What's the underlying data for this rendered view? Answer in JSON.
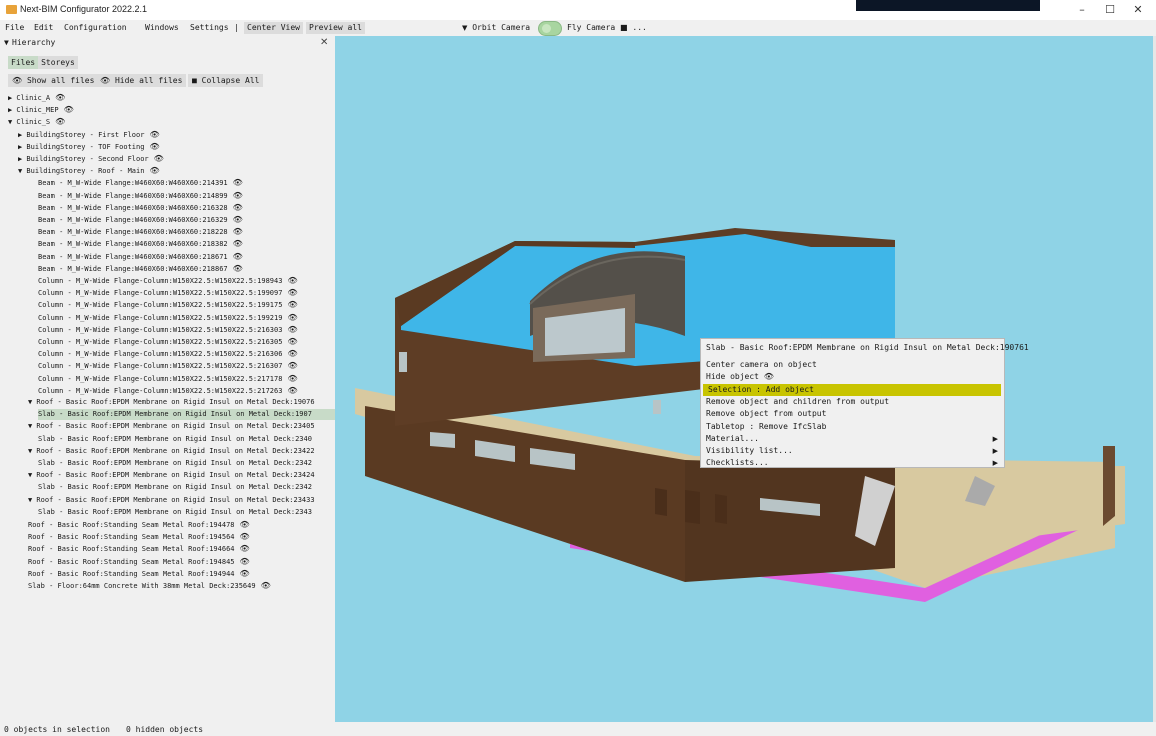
{
  "window": {
    "title": "Next-BIM Configurator 2022.2.1",
    "controls": {
      "minimize": "–",
      "maximize": "☐",
      "close": "✕"
    }
  },
  "menu": {
    "items": [
      "File",
      "Edit",
      "Configuration",
      "Windows",
      "Settings",
      "|",
      "Center View",
      "Preview all"
    ],
    "orbit_camera": "Orbit Camera",
    "fly_camera": "Fly Camera",
    "more": "..."
  },
  "hierarchy": {
    "title": "Hierarchy",
    "close": "✕",
    "tabs": [
      "Files",
      "Storeys"
    ],
    "toolbar": {
      "show_all": "Show all files",
      "hide_all": "Hide all files",
      "collapse_all": "Collapse All"
    },
    "tree": [
      {
        "text": "▶ Clinic_A",
        "indent": 0,
        "eye": true
      },
      {
        "text": "▶ Clinic_MEP",
        "indent": 0,
        "eye": true
      },
      {
        "text": "▼ Clinic_S",
        "indent": 0,
        "eye": true
      },
      {
        "text": "▶ BuildingStorey - First Floor",
        "indent": 1,
        "eye": true
      },
      {
        "text": "▶ BuildingStorey - TOF Footing",
        "indent": 1,
        "eye": true
      },
      {
        "text": "▶ BuildingStorey - Second Floor",
        "indent": 1,
        "eye": true
      },
      {
        "text": "▼ BuildingStorey - Roof - Main",
        "indent": 1,
        "eye": true
      },
      {
        "text": "Beam - M_W-Wide Flange:W460X60:W460X60:214391",
        "indent": 3,
        "eye": true
      },
      {
        "text": "Beam - M_W-Wide Flange:W460X60:W460X60:214899",
        "indent": 3,
        "eye": true
      },
      {
        "text": "Beam - M_W-Wide Flange:W460X60:W460X60:216328",
        "indent": 3,
        "eye": true
      },
      {
        "text": "Beam - M_W-Wide Flange:W460X60:W460X60:216329",
        "indent": 3,
        "eye": true
      },
      {
        "text": "Beam - M_W-Wide Flange:W460X60:W460X60:218228",
        "indent": 3,
        "eye": true
      },
      {
        "text": "Beam - M_W-Wide Flange:W460X60:W460X60:218382",
        "indent": 3,
        "eye": true
      },
      {
        "text": "Beam - M_W-Wide Flange:W460X60:W460X60:218671",
        "indent": 3,
        "eye": true
      },
      {
        "text": "Beam - M_W-Wide Flange:W460X60:W460X60:218867",
        "indent": 3,
        "eye": true
      },
      {
        "text": "Column - M_W-Wide Flange-Column:W150X22.5:W150X22.5:198943",
        "indent": 3,
        "eye": true
      },
      {
        "text": "Column - M_W-Wide Flange-Column:W150X22.5:W150X22.5:199097",
        "indent": 3,
        "eye": true
      },
      {
        "text": "Column - M_W-Wide Flange-Column:W150X22.5:W150X22.5:199175",
        "indent": 3,
        "eye": true
      },
      {
        "text": "Column - M_W-Wide Flange-Column:W150X22.5:W150X22.5:199219",
        "indent": 3,
        "eye": true
      },
      {
        "text": "Column - M_W-Wide Flange-Column:W150X22.5:W150X22.5:216303",
        "indent": 3,
        "eye": true
      },
      {
        "text": "Column - M_W-Wide Flange-Column:W150X22.5:W150X22.5:216305",
        "indent": 3,
        "eye": true
      },
      {
        "text": "Column - M_W-Wide Flange-Column:W150X22.5:W150X22.5:216306",
        "indent": 3,
        "eye": true
      },
      {
        "text": "Column - M_W-Wide Flange-Column:W150X22.5:W150X22.5:216307",
        "indent": 3,
        "eye": true
      },
      {
        "text": "Column - M_W-Wide Flange-Column:W150X22.5:W150X22.5:217178",
        "indent": 3,
        "eye": true
      },
      {
        "text": "Column - M_W-Wide Flange-Column:W150X22.5:W150X22.5:217263",
        "indent": 3,
        "eye": true
      },
      {
        "text": "▼ Roof - Basic Roof:EPDM Membrane on Rigid Insul on Metal Deck:19076",
        "indent": 2,
        "eye": false
      },
      {
        "text": "Slab - Basic Roof:EPDM Membrane on Rigid Insul on Metal Deck:1907",
        "indent": 3,
        "eye": false,
        "selected": true
      },
      {
        "text": "▼ Roof - Basic Roof:EPDM Membrane on Rigid Insul on Metal Deck:23405",
        "indent": 2,
        "eye": false
      },
      {
        "text": "Slab - Basic Roof:EPDM Membrane on Rigid Insul on Metal Deck:2340",
        "indent": 3,
        "eye": false
      },
      {
        "text": "▼ Roof - Basic Roof:EPDM Membrane on Rigid Insul on Metal Deck:23422",
        "indent": 2,
        "eye": false
      },
      {
        "text": "Slab - Basic Roof:EPDM Membrane on Rigid Insul on Metal Deck:2342",
        "indent": 3,
        "eye": false
      },
      {
        "text": "▼ Roof - Basic Roof:EPDM Membrane on Rigid Insul on Metal Deck:23424",
        "indent": 2,
        "eye": false
      },
      {
        "text": "Slab - Basic Roof:EPDM Membrane on Rigid Insul on Metal Deck:2342",
        "indent": 3,
        "eye": false
      },
      {
        "text": "▼ Roof - Basic Roof:EPDM Membrane on Rigid Insul on Metal Deck:23433",
        "indent": 2,
        "eye": false
      },
      {
        "text": "Slab - Basic Roof:EPDM Membrane on Rigid Insul on Metal Deck:2343",
        "indent": 3,
        "eye": false
      },
      {
        "text": "Roof - Basic Roof:Standing Seam Metal Roof:194478",
        "indent": 2,
        "eye": true
      },
      {
        "text": "Roof - Basic Roof:Standing Seam Metal Roof:194564",
        "indent": 2,
        "eye": true
      },
      {
        "text": "Roof - Basic Roof:Standing Seam Metal Roof:194664",
        "indent": 2,
        "eye": true
      },
      {
        "text": "Roof - Basic Roof:Standing Seam Metal Roof:194845",
        "indent": 2,
        "eye": true
      },
      {
        "text": "Roof - Basic Roof:Standing Seam Metal Roof:194944",
        "indent": 2,
        "eye": true
      },
      {
        "text": "Slab - Floor:64mm Concrete With 38mm Metal Deck:235649",
        "indent": 2,
        "eye": true
      }
    ]
  },
  "context_menu": {
    "title": "Slab - Basic Roof:EPDM Membrane on Rigid Insul on Metal Deck:190761",
    "items": [
      {
        "label": "Center camera on object",
        "submenu": false,
        "highlighted": false
      },
      {
        "label": "Hide object 👁",
        "submenu": false,
        "highlighted": false
      },
      {
        "label": "Selection : Add object",
        "submenu": false,
        "highlighted": true
      },
      {
        "label": "Remove object and children from output",
        "submenu": false,
        "highlighted": false
      },
      {
        "label": "Remove object from output",
        "submenu": false,
        "highlighted": false
      },
      {
        "label": "Tabletop : Remove IfcSlab",
        "submenu": false,
        "highlighted": false
      },
      {
        "label": "Material...",
        "submenu": true,
        "highlighted": false
      },
      {
        "label": "Visibility list...",
        "submenu": true,
        "highlighted": false
      },
      {
        "label": "Checklists...",
        "submenu": true,
        "highlighted": false
      }
    ]
  },
  "status": {
    "selection": "0 objects in selection",
    "hidden": "0 hidden objects"
  },
  "colors": {
    "sky": "#8fd3e6",
    "roof_membrane": "#3fb6e8",
    "brick": "#5a3a22",
    "sand": "#d8c9a0",
    "magenta": "#e060e0",
    "highlight": "#c8c400"
  }
}
